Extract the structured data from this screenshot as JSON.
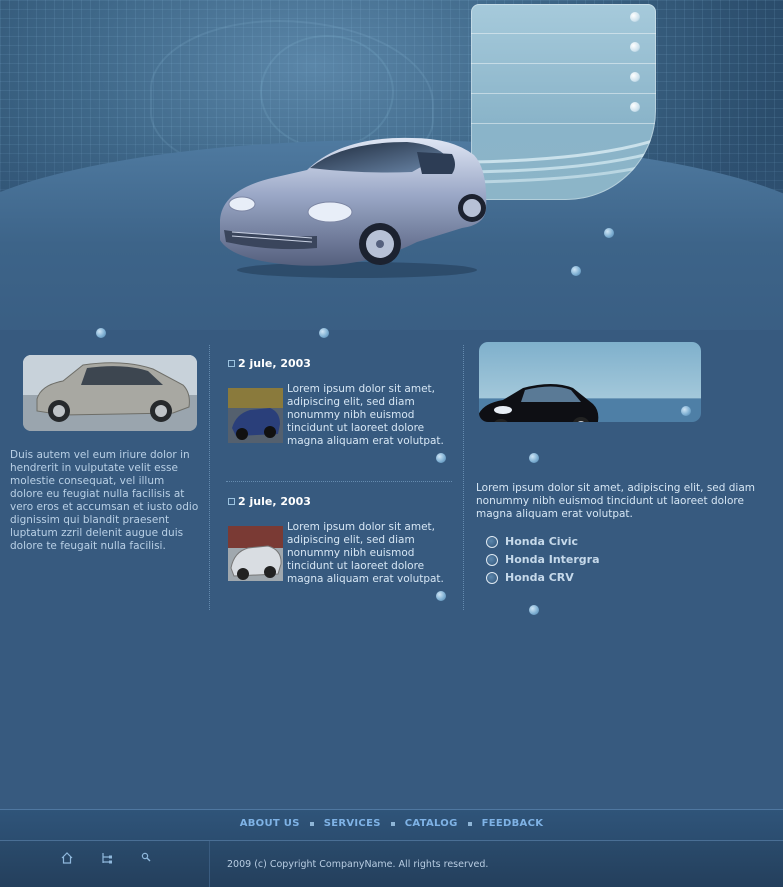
{
  "header": {
    "menu_items": 4,
    "hero_alt": "silver sports car"
  },
  "left": {
    "text": "Duis autem vel eum iriure dolor in hendrerit in vulputate velit esse molestie consequat, vel illum dolore eu feugiat nulla facilisis at vero eros et accumsan et iusto odio dignissim qui blandit praesent luptatum zzril delenit augue duis dolore te feugait nulla facilisi."
  },
  "news": [
    {
      "date": "2 jule, 2003",
      "text": "Lorem ipsum dolor sit amet, adipiscing elit, sed diam nonummy nibh euismod tincidunt ut laoreet dolore magna aliquam erat volutpat."
    },
    {
      "date": "2 jule, 2003",
      "text": "Lorem ipsum dolor sit amet, adipiscing elit, sed diam nonummy nibh euismod tincidunt ut laoreet dolore magna aliquam erat volutpat."
    }
  ],
  "right": {
    "text": "Lorem ipsum dolor sit amet, adipiscing elit, sed diam nonummy nibh euismod tincidunt ut laoreet dolore magna aliquam erat volutpat.",
    "models": [
      "Honda Civic",
      "Honda Intergra",
      "Honda CRV"
    ]
  },
  "footer": {
    "nav": [
      "ABOUT US",
      "SERVICES",
      "CATALOG",
      "FEEDBACK"
    ],
    "icons": [
      "home-icon",
      "sitemap-icon",
      "search-icon"
    ],
    "copyright": "2009 (c) Copyright CompanyName. All rights reserved."
  },
  "colors": {
    "background": "#375a7f",
    "accent": "#7fb3e6",
    "panel": "#a6cadb"
  }
}
